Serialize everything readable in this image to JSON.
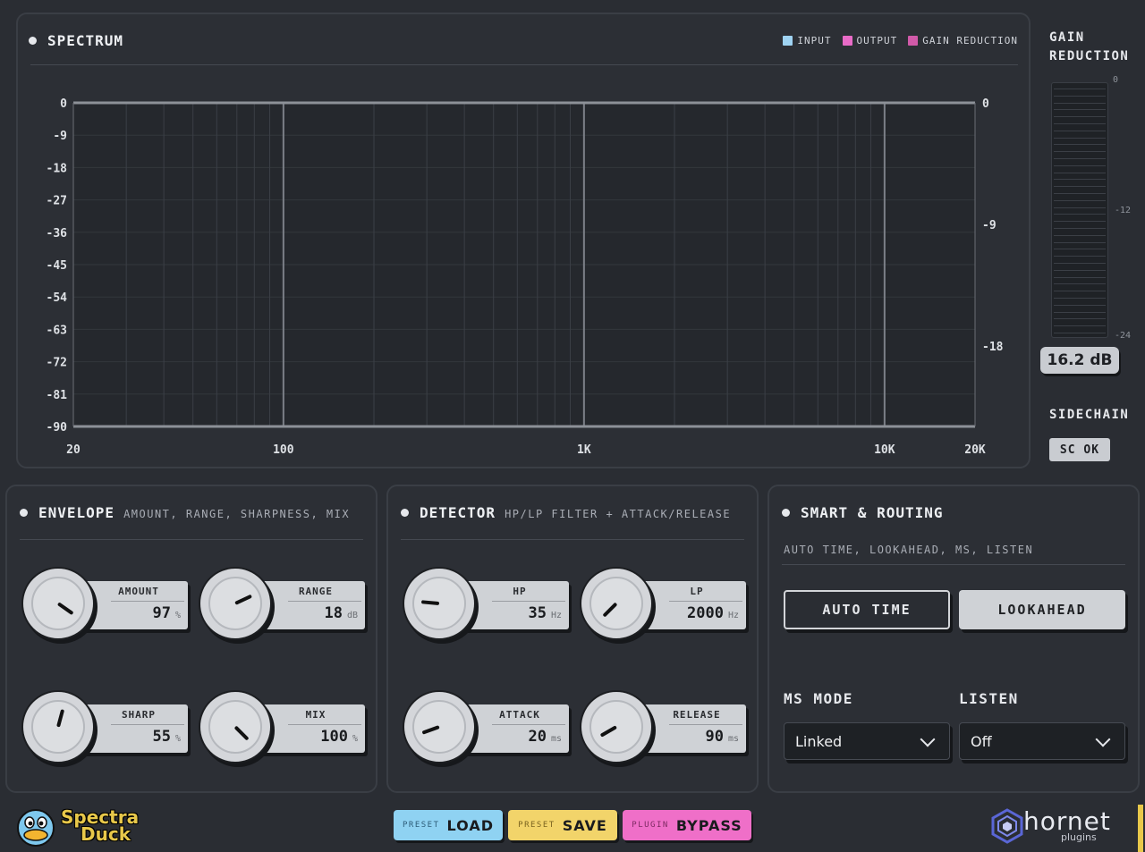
{
  "spectrum": {
    "title": "SPECTRUM",
    "legend": [
      {
        "label": "INPUT",
        "color": "#9fd3f2"
      },
      {
        "label": "OUTPUT",
        "color": "#e86bc7"
      },
      {
        "label": "GAIN REDUCTION",
        "color": "#d15aa9"
      }
    ],
    "y_left_ticks": [
      "0",
      "-9",
      "-18",
      "-27",
      "-36",
      "-45",
      "-54",
      "-63",
      "-72",
      "-81",
      "-90"
    ],
    "y_right_ticks": [
      "0",
      "-9",
      "-18"
    ],
    "x_ticks": [
      "20",
      "100",
      "1K",
      "10K",
      "20K"
    ]
  },
  "gain_reduction": {
    "title_line1": "GAIN",
    "title_line2": "REDUCTION",
    "ticks": [
      "0",
      "-12",
      "-24"
    ],
    "readout": "16.2 dB"
  },
  "sidechain": {
    "title": "SIDECHAIN",
    "status": "SC OK"
  },
  "envelope": {
    "title": "ENVELOPE",
    "subtitle": "AMOUNT, RANGE, SHARPNESS, MIX",
    "controls": [
      {
        "label": "AMOUNT",
        "value": "97",
        "unit": "%"
      },
      {
        "label": "RANGE",
        "value": "18",
        "unit": "dB"
      },
      {
        "label": "SHARP",
        "value": "55",
        "unit": "%"
      },
      {
        "label": "MIX",
        "value": "100",
        "unit": "%"
      }
    ]
  },
  "detector": {
    "title": "DETECTOR",
    "subtitle": "HP/LP FILTER + ATTACK/RELEASE",
    "controls": [
      {
        "label": "HP",
        "value": "35",
        "unit": "Hz"
      },
      {
        "label": "LP",
        "value": "2000",
        "unit": "Hz"
      },
      {
        "label": "ATTACK",
        "value": "20",
        "unit": "ms"
      },
      {
        "label": "RELEASE",
        "value": "90",
        "unit": "ms"
      }
    ]
  },
  "smart": {
    "title": "SMART & ROUTING",
    "subtitle": "AUTO TIME, LOOKAHEAD, MS, LISTEN",
    "auto_time": "AUTO TIME",
    "lookahead": "LOOKAHEAD",
    "ms_mode_label": "MS MODE",
    "ms_mode_value": "Linked",
    "listen_label": "LISTEN",
    "listen_value": "Off"
  },
  "footer": {
    "brand_line1": "Spectra",
    "brand_line2": "Duck",
    "preset_load_small": "PRESET",
    "preset_load_big": "LOAD",
    "preset_save_small": "PRESET",
    "preset_save_big": "SAVE",
    "bypass_small": "PLUGIN",
    "bypass_big": "BYPASS",
    "maker_name": "hornet",
    "maker_sub": "plugins"
  }
}
